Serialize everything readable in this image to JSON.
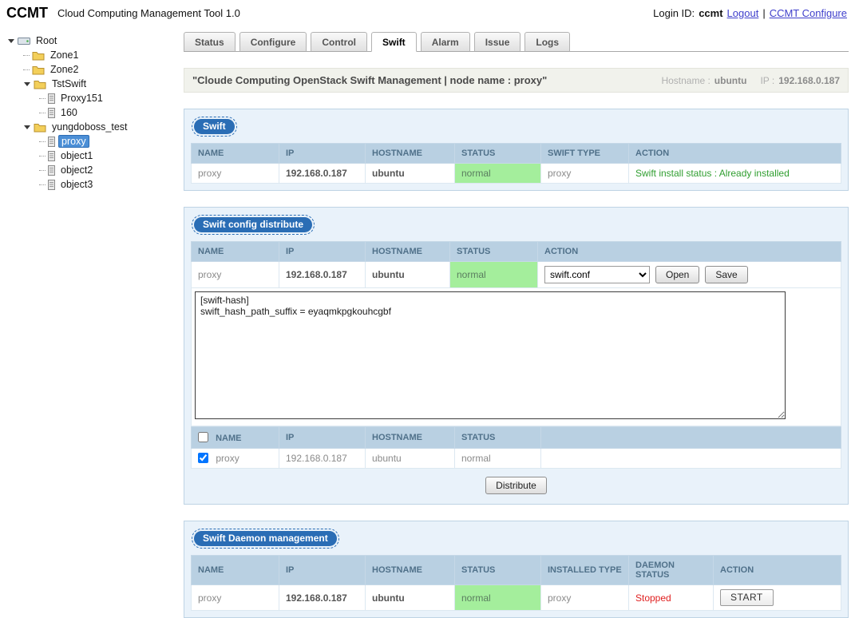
{
  "topbar": {
    "logo": "CCMT",
    "app_title": "Cloud Computing Management Tool 1.0",
    "login_label": "Login ID:",
    "login_id": "ccmt",
    "logout_label": "Logout",
    "separator": "|",
    "configure_label": "CCMT Configure"
  },
  "tree": {
    "items": [
      {
        "label": "Root"
      },
      {
        "label": "Zone1"
      },
      {
        "label": "Zone2"
      },
      {
        "label": "TstSwift"
      },
      {
        "label": "Proxy151"
      },
      {
        "label": "160"
      },
      {
        "label": "yungdoboss_test"
      },
      {
        "label": "proxy"
      },
      {
        "label": "object1"
      },
      {
        "label": "object2"
      },
      {
        "label": "object3"
      }
    ]
  },
  "tabs": [
    {
      "label": "Status"
    },
    {
      "label": "Configure"
    },
    {
      "label": "Control"
    },
    {
      "label": "Swift"
    },
    {
      "label": "Alarm"
    },
    {
      "label": "Issue"
    },
    {
      "label": "Logs"
    }
  ],
  "page_header": {
    "title": "\"Cloude Computing OpenStack Swift Management | node name : proxy\"",
    "hostname_label": "Hostname :",
    "hostname_value": "ubuntu",
    "ip_label": "IP :",
    "ip_value": "192.168.0.187"
  },
  "swift_section": {
    "badge": "Swift",
    "columns": [
      "NAME",
      "IP",
      "HOSTNAME",
      "STATUS",
      "SWIFT TYPE",
      "ACTION"
    ],
    "row": {
      "name": "proxy",
      "ip": "192.168.0.187",
      "hostname": "ubuntu",
      "status": "normal",
      "swift_type": "proxy",
      "action": "Swift install status : Already installed"
    }
  },
  "config_section": {
    "badge": "Swift config distribute",
    "columns": [
      "NAME",
      "IP",
      "HOSTNAME",
      "STATUS",
      "ACTION"
    ],
    "row": {
      "name": "proxy",
      "ip": "192.168.0.187",
      "hostname": "ubuntu",
      "status": "normal"
    },
    "file_select_value": "swift.conf",
    "open_label": "Open",
    "save_label": "Save",
    "config_text": "[swift-hash]\nswift_hash_path_suffix = eyaqmkpgkouhcgbf",
    "dist_columns": [
      "NAME",
      "IP",
      "HOSTNAME",
      "STATUS"
    ],
    "dist_row": {
      "name": "proxy",
      "ip": "192.168.0.187",
      "hostname": "ubuntu",
      "status": "normal"
    },
    "distribute_label": "Distribute"
  },
  "daemon_section": {
    "badge": "Swift Daemon management",
    "columns": [
      "NAME",
      "IP",
      "HOSTNAME",
      "STATUS",
      "INSTALLED TYPE",
      "DAEMON STATUS",
      "ACTION"
    ],
    "row": {
      "name": "proxy",
      "ip": "192.168.0.187",
      "hostname": "ubuntu",
      "status": "normal",
      "installed_type": "proxy",
      "daemon_status": "Stopped",
      "action_label": "START"
    }
  },
  "colors": {
    "accent_blue": "#2a6db5",
    "table_header_blue": "#b9d0e2",
    "status_green_bg": "#a4ee9c",
    "ok_green_text": "#2f9e2f",
    "error_red_text": "#e02020"
  }
}
